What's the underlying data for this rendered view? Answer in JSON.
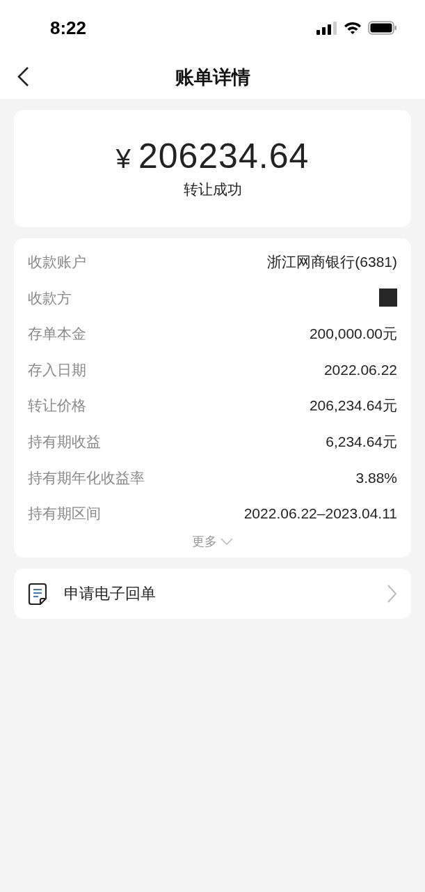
{
  "status_bar": {
    "time": "8:22"
  },
  "header": {
    "title": "账单详情"
  },
  "summary": {
    "currency": "¥",
    "amount": "206234.64",
    "status": "转让成功"
  },
  "details": [
    {
      "label": "收款账户",
      "kind": "text",
      "value": "浙江网商银行(6381)"
    },
    {
      "label": "收款方",
      "kind": "redacted"
    },
    {
      "label": "存单本金",
      "kind": "text",
      "value": "200,000.00元"
    },
    {
      "label": "存入日期",
      "kind": "text",
      "value": "2022.06.22"
    },
    {
      "label": "转让价格",
      "kind": "text",
      "value": "206,234.64元"
    },
    {
      "label": "持有期收益",
      "kind": "text",
      "value": "6,234.64元"
    },
    {
      "label": "持有期年化收益率",
      "kind": "text",
      "value": "3.88%"
    },
    {
      "label": "持有期区间",
      "kind": "text",
      "value": "2022.06.22–2023.04.11"
    }
  ],
  "more": {
    "label": "更多",
    "expanded": false
  },
  "receipt": {
    "label": "申请电子回单"
  }
}
